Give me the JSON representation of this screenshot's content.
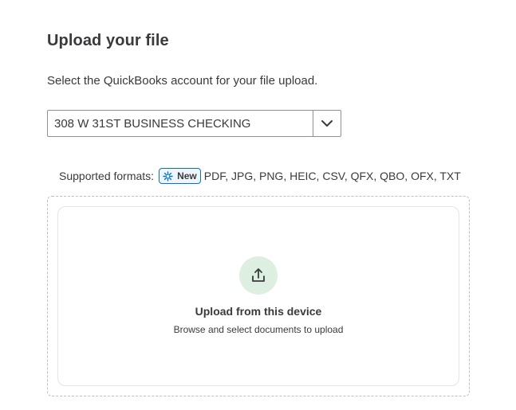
{
  "header": {
    "title": "Upload your file",
    "subtitle": "Select the QuickBooks account for your file upload."
  },
  "account_select": {
    "value": "308 W 31ST BUSINESS CHECKING",
    "caret_icon": "chevron-down-icon"
  },
  "formats": {
    "label": "Supported formats:",
    "badge": "New",
    "badge_icon": "sparkle-icon",
    "list": "PDF, JPG, PNG, HEIC, CSV, QFX, QBO, OFX, TXT"
  },
  "dropzone": {
    "icon": "upload-icon",
    "title": "Upload from this device",
    "subtitle": "Browse and select documents to upload"
  },
  "colors": {
    "badge_border": "#0077c5",
    "upload_circle": "#dcefe0",
    "text": "#393a3d"
  }
}
